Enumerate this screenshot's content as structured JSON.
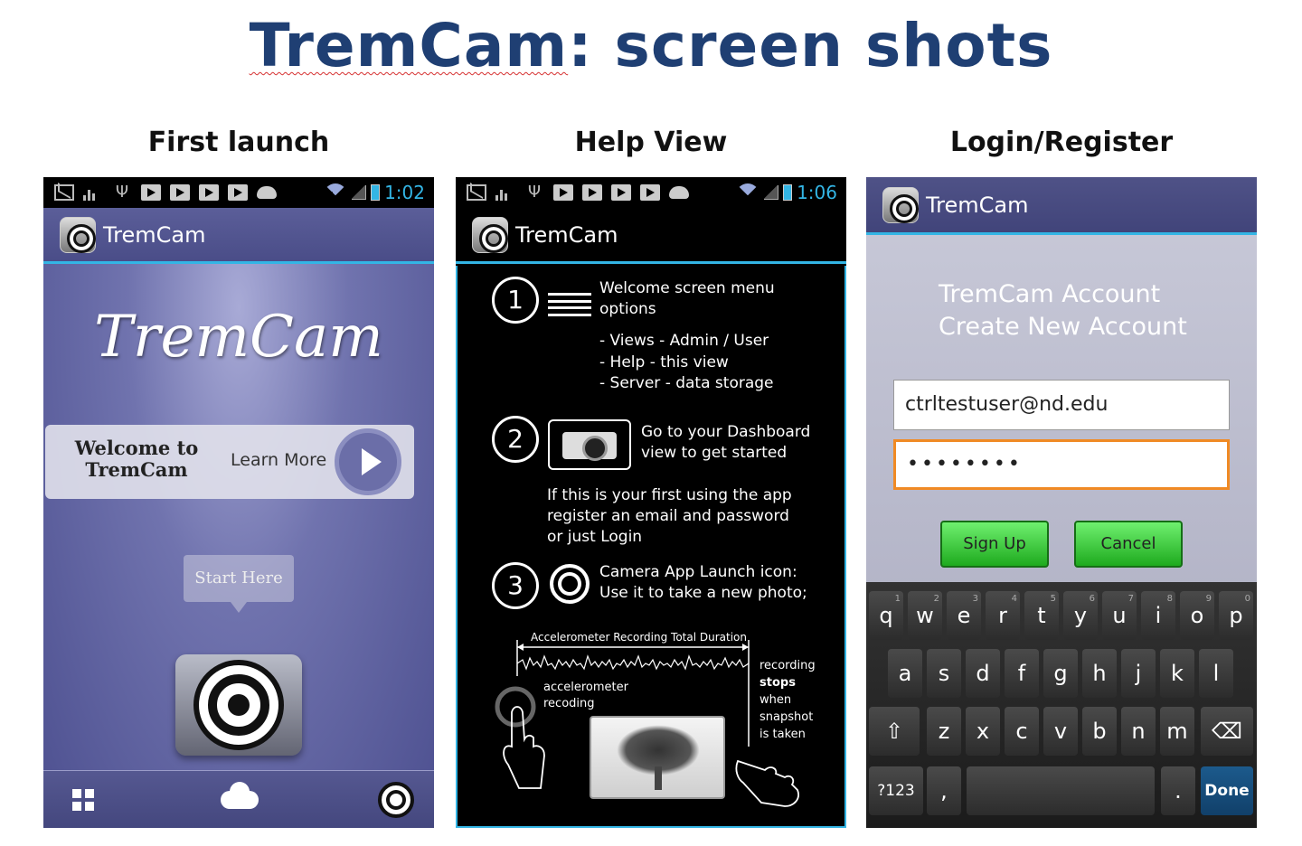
{
  "page": {
    "title_part1": "TremCam",
    "title_part2": ": screen shots",
    "captions": [
      "First launch",
      "Help View",
      "Login/Register"
    ]
  },
  "status_bars": [
    {
      "time": "1:02"
    },
    {
      "time": "1:06"
    }
  ],
  "app_name": "TremCam",
  "first_launch": {
    "logo_text": "TremCam",
    "welcome_text": "Welcome to TremCam",
    "learn_more": "Learn More",
    "start_here": "Start Here"
  },
  "help_view": {
    "steps": [
      {
        "number": "1",
        "text": "Welcome screen menu options"
      },
      {
        "number": "2",
        "text": "Go to your Dashboard view to get started"
      },
      {
        "number": "3",
        "text": "Camera App Launch icon: Use it to take a new photo;"
      }
    ],
    "menu_options": [
      "- Views - Admin / User",
      "- Help - this view",
      "- Server - data storage"
    ],
    "first_use_note": "If this is your first using the app register an email and password or just Login",
    "diagram": {
      "duration_label": "Accelerometer Recording Total Duration",
      "accel_label_1": "accelerometer",
      "accel_label_2": "recoding",
      "stop_lines": [
        "recording",
        "stops",
        "when",
        "snapshot",
        "is  taken"
      ]
    }
  },
  "login": {
    "account_line1": "TremCam Account",
    "account_line2": "Create New Account",
    "email_value": "ctrltestuser@nd.edu",
    "password_masked": "••••••••",
    "signup_label": "Sign Up",
    "cancel_label": "Cancel"
  },
  "keyboard": {
    "row1": [
      "q",
      "w",
      "e",
      "r",
      "t",
      "y",
      "u",
      "i",
      "o",
      "p"
    ],
    "row1_hints": [
      "1",
      "2",
      "3",
      "4",
      "5",
      "6",
      "7",
      "8",
      "9",
      "0"
    ],
    "row2": [
      "a",
      "s",
      "d",
      "f",
      "g",
      "h",
      "j",
      "k",
      "l"
    ],
    "row3": [
      "z",
      "x",
      "c",
      "v",
      "b",
      "n",
      "m"
    ],
    "symbols_key": "?123",
    "comma_key": ",",
    "period_key": ".",
    "done_key": "Done"
  }
}
